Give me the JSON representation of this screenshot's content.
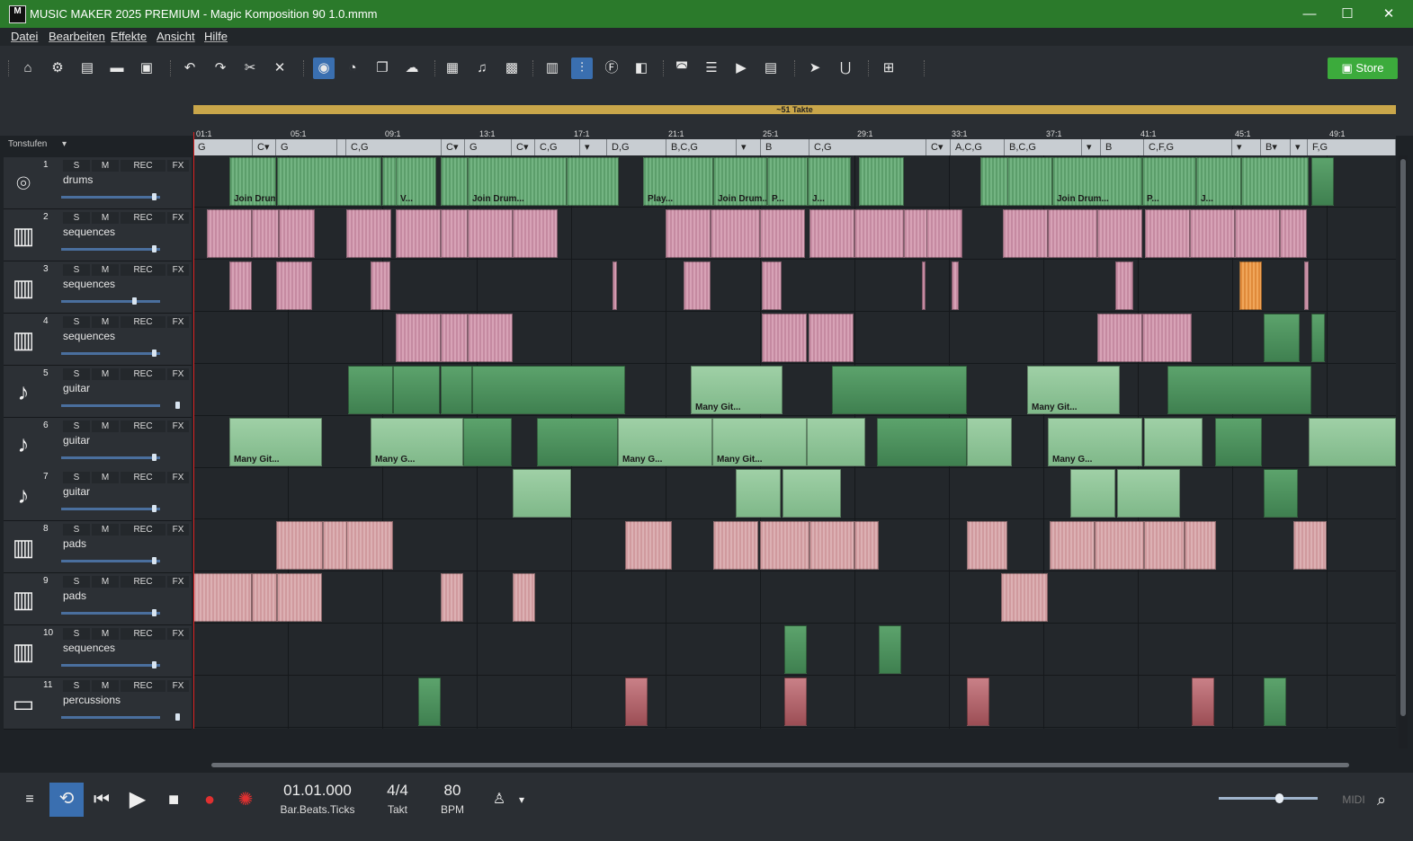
{
  "window": {
    "title": "MUSIC MAKER 2025 PREMIUM - Magic Komposition 90 1.0.mmm",
    "app_icon_label": "M",
    "min": "—",
    "max": "☐",
    "close": "✕"
  },
  "menu": [
    "Datei",
    "Bearbeiten",
    "Effekte",
    "Ansicht",
    "Hilfe"
  ],
  "toolbar": {
    "store_label": "Store",
    "icons": [
      "home-icon",
      "gear-icon",
      "new-file-icon",
      "open-folder-icon",
      "save-icon",
      "undo-icon",
      "redo-icon",
      "cut-icon",
      "delete-icon",
      "mixer-icon",
      "tempo-icon",
      "copy-icon",
      "cloud-icon",
      "grid-icon",
      "note-icon",
      "beatbox-icon",
      "piano-icon",
      "equalizer-icon",
      "fx-icon",
      "song-maker-icon",
      "image-icon",
      "list-icon",
      "video-icon",
      "film-icon",
      "pointer-icon",
      "snap-icon",
      "add-icon"
    ]
  },
  "arranger": {
    "takte_label": "~51 Takte",
    "tonstufen_label": "Tonstufen",
    "bar_markers": [
      "01:1",
      "05:1",
      "09:1",
      "13:1",
      "17:1",
      "21:1",
      "25:1",
      "29:1",
      "33:1",
      "37:1",
      "41:1",
      "45:1",
      "49:1"
    ],
    "chords": [
      "G",
      "C▾",
      "G",
      "",
      "C,G",
      "C▾",
      "G",
      "C▾",
      "C,G",
      "▾",
      "D,G",
      "B,C,G",
      "▾",
      "B",
      "C,G",
      "C▾",
      "A,C,G",
      "B,C,G",
      "▾",
      "B",
      "C,F,G",
      "▾",
      "B▾",
      "▾",
      "F,G"
    ]
  },
  "tracks": [
    {
      "num": "1",
      "name": "drums",
      "icon": "drum-kit-icon",
      "volume": 0.78,
      "type": "drums"
    },
    {
      "num": "2",
      "name": "sequences",
      "icon": "keyboard-icon",
      "volume": 0.78,
      "type": "seq"
    },
    {
      "num": "3",
      "name": "sequences",
      "icon": "keyboard-icon",
      "volume": 0.62,
      "type": "seq"
    },
    {
      "num": "4",
      "name": "sequences",
      "icon": "keyboard-icon",
      "volume": 0.78,
      "type": "seq"
    },
    {
      "num": "5",
      "name": "guitar",
      "icon": "guitar-icon",
      "volume": 0.98,
      "type": "guitar"
    },
    {
      "num": "6",
      "name": "guitar",
      "icon": "guitar-icon",
      "volume": 0.78,
      "type": "guitar"
    },
    {
      "num": "7",
      "name": "guitar",
      "icon": "guitar-icon",
      "volume": 0.78,
      "type": "guitar"
    },
    {
      "num": "8",
      "name": "pads",
      "icon": "keyboard-icon",
      "volume": 0.78,
      "type": "pads"
    },
    {
      "num": "9",
      "name": "pads",
      "icon": "keyboard-icon",
      "volume": 0.78,
      "type": "pads"
    },
    {
      "num": "10",
      "name": "sequences",
      "icon": "keyboard-icon",
      "volume": 0.78,
      "type": "seq"
    },
    {
      "num": "11",
      "name": "percussions",
      "icon": "conga-icon",
      "volume": 0.98,
      "type": "perc"
    }
  ],
  "track_buttons": {
    "solo": "S",
    "mute": "M",
    "rec": "REC",
    "fx": "FX"
  },
  "clip_labels": [
    "Join Drums F_o...",
    "V...",
    "Join Drum...",
    "Play...",
    "Join Drum...",
    "P...",
    "J...",
    "Join Drum...",
    "P...",
    "J...",
    "Many Git...",
    "Many Git...",
    "Many Git...",
    "Many G...",
    "Many G...",
    "Many Git...",
    "Many G..."
  ],
  "transport": {
    "position": "01.01.000",
    "position_label": "Bar.Beats.Ticks",
    "time_sig": "4/4",
    "time_sig_label": "Takt",
    "bpm": "80",
    "bpm_label": "BPM",
    "midi_label": "MIDI",
    "zoom": 0.6
  },
  "colors": {
    "titlebar": "#2b7a2b",
    "accent": "#3a6fb0",
    "store": "#3cab3c",
    "playhead": "#dd2222"
  }
}
